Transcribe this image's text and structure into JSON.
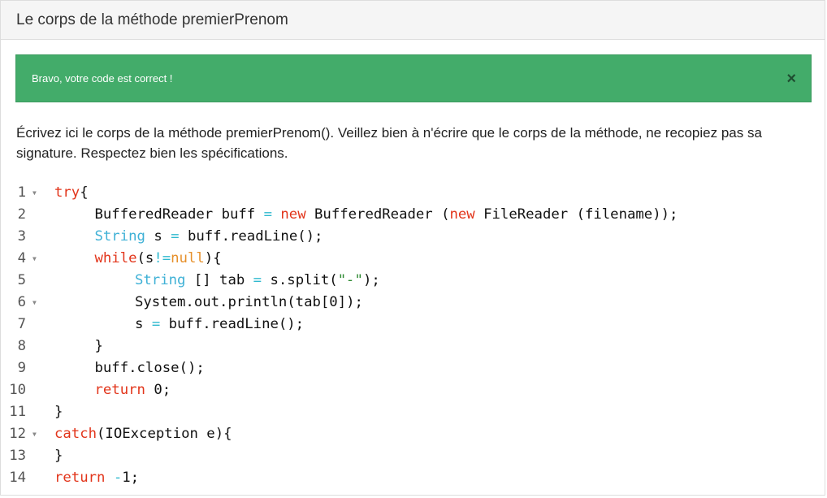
{
  "panel": {
    "title": "Le corps de la méthode premierPrenom"
  },
  "alert": {
    "message": "Bravo, votre code est correct !",
    "close_label": "×"
  },
  "instructions": "Écrivez ici le corps de la méthode premierPrenom(). Veillez bien à n'écrire que le corps de la méthode, ne recopiez pas sa signature. Respectez bien les spécifications.",
  "editor": {
    "fold_icon": "▼",
    "lines": [
      {
        "n": "1",
        "fold": true,
        "indent": 0,
        "tokens": [
          [
            "kw",
            "try"
          ],
          [
            "pl",
            "{"
          ]
        ]
      },
      {
        "n": "2",
        "fold": false,
        "indent": 1,
        "tokens": [
          [
            "pl",
            "BufferedReader buff "
          ],
          [
            "op",
            "="
          ],
          [
            "pl",
            " "
          ],
          [
            "kw",
            "new"
          ],
          [
            "pl",
            " BufferedReader ("
          ],
          [
            "kw",
            "new"
          ],
          [
            "pl",
            " FileReader (filename));"
          ]
        ]
      },
      {
        "n": "3",
        "fold": false,
        "indent": 1,
        "tokens": [
          [
            "ty",
            "String"
          ],
          [
            "pl",
            " s "
          ],
          [
            "op",
            "="
          ],
          [
            "pl",
            " buff.readLine();"
          ]
        ]
      },
      {
        "n": "4",
        "fold": true,
        "indent": 1,
        "tokens": [
          [
            "kw",
            "while"
          ],
          [
            "pl",
            "(s"
          ],
          [
            "op",
            "!="
          ],
          [
            "nu",
            "null"
          ],
          [
            "pl",
            "){"
          ]
        ]
      },
      {
        "n": "5",
        "fold": false,
        "indent": 2,
        "tokens": [
          [
            "ty",
            "String"
          ],
          [
            "pl",
            " [] tab "
          ],
          [
            "op",
            "="
          ],
          [
            "pl",
            " s.split("
          ],
          [
            "st",
            "\"-\""
          ],
          [
            "pl",
            ");"
          ]
        ]
      },
      {
        "n": "6",
        "fold": true,
        "indent": 2,
        "tokens": [
          [
            "pl",
            "System.out.println(tab[0]);"
          ]
        ]
      },
      {
        "n": "7",
        "fold": false,
        "indent": 2,
        "tokens": [
          [
            "pl",
            "s "
          ],
          [
            "op",
            "="
          ],
          [
            "pl",
            " buff.readLine();"
          ]
        ]
      },
      {
        "n": "8",
        "fold": false,
        "indent": 1,
        "tokens": [
          [
            "pl",
            "}"
          ]
        ]
      },
      {
        "n": "9",
        "fold": false,
        "indent": 1,
        "tokens": [
          [
            "pl",
            "buff.close();"
          ]
        ]
      },
      {
        "n": "10",
        "fold": false,
        "indent": 1,
        "tokens": [
          [
            "kw",
            "return"
          ],
          [
            "pl",
            " 0;"
          ]
        ]
      },
      {
        "n": "11",
        "fold": false,
        "indent": 0,
        "tokens": [
          [
            "pl",
            "}"
          ]
        ]
      },
      {
        "n": "12",
        "fold": true,
        "indent": 0,
        "tokens": [
          [
            "kw",
            "catch"
          ],
          [
            "pl",
            "(IOException e){"
          ]
        ]
      },
      {
        "n": "13",
        "fold": false,
        "indent": 0,
        "tokens": [
          [
            "pl",
            "}"
          ]
        ]
      },
      {
        "n": "14",
        "fold": false,
        "indent": 0,
        "tokens": [
          [
            "kw",
            "return"
          ],
          [
            "pl",
            " "
          ],
          [
            "op",
            "-"
          ],
          [
            "pl",
            "1;"
          ]
        ]
      }
    ]
  }
}
